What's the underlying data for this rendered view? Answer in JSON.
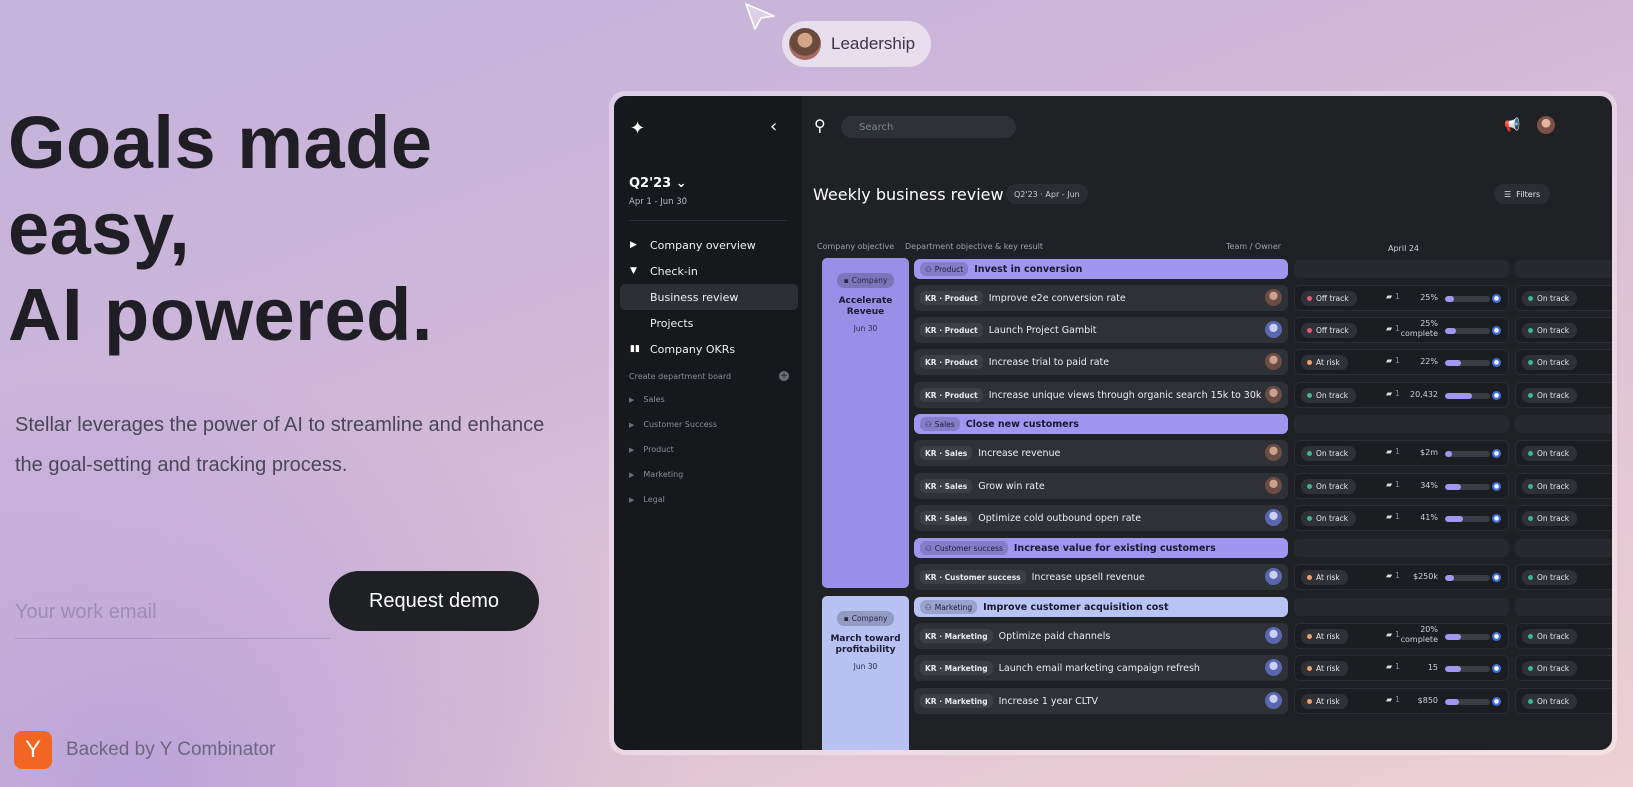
{
  "hero": {
    "title_line1": "Goals made",
    "title_line2": "easy,",
    "title_line3": "AI powered.",
    "subtitle": "Stellar leverages the power of AI to streamline and enhance the goal-setting and tracking process.",
    "email_placeholder": "Your work email",
    "cta_label": "Request demo",
    "backed_logo": "Y",
    "backed_text": "Backed by Y Combinator"
  },
  "cursor_chip": {
    "label": "Leadership"
  },
  "app": {
    "sidebar": {
      "quarter": "Q2'23",
      "range": "Apr 1 - Jun 30",
      "nav": [
        {
          "label": "Company overview"
        },
        {
          "label": "Check-in"
        },
        {
          "label": "Business review"
        },
        {
          "label": "Projects"
        },
        {
          "label": "Company OKRs"
        }
      ],
      "create_label": "Create department board",
      "departments": [
        "Sales",
        "Customer Success",
        "Product",
        "Marketing",
        "Legal"
      ]
    },
    "search_placeholder": "Search",
    "page_title": "Weekly business review",
    "quarter_pill": "Q2'23 · Apr - Jun",
    "filters_label": "Filters",
    "col_company": "Company objective",
    "col_dept": "Department objective & key result",
    "col_team": "Team / Owner",
    "col_date": "April 24",
    "objectives": [
      {
        "tag": "Company",
        "title": "Accelerate Reveue",
        "date": "Jun 30"
      },
      {
        "tag": "Company",
        "title": "March toward profitability",
        "date": "Jun 30"
      }
    ],
    "colors": {
      "on_track": "#3fb58a",
      "off_track": "#e4587a",
      "at_risk": "#f0a06a",
      "accent": "#a195ef"
    },
    "rows": [
      {
        "kind": "head",
        "style": "purple",
        "tag": "Product",
        "title": "Invest in conversion"
      },
      {
        "kind": "kr",
        "tag": "KR · Product",
        "title": "Improve e2e conversion rate",
        "status": "Off track",
        "dot": "off_track",
        "comments": "1",
        "value": "25%",
        "progress": 0.2,
        "owner": "brown",
        "status2": "On track"
      },
      {
        "kind": "kr",
        "tag": "KR · Product",
        "title": "Launch Project Gambit",
        "status": "Off track",
        "dot": "off_track",
        "comments": "1",
        "value": "25%",
        "value2": "complete",
        "progress": 0.25,
        "owner": "blue",
        "status2": "On track"
      },
      {
        "kind": "kr",
        "tag": "KR · Product",
        "title": "Increase trial to paid rate",
        "status": "At risk",
        "dot": "at_risk",
        "comments": "1",
        "value": "22%",
        "progress": 0.35,
        "owner": "brown",
        "status2": "On track"
      },
      {
        "kind": "kr",
        "tag": "KR · Product",
        "title": "Increase unique views through organic search 15k to 30k",
        "status": "On track",
        "dot": "on_track",
        "comments": "1",
        "value": "20,432",
        "progress": 0.6,
        "owner": "brown",
        "status2": "On track"
      },
      {
        "kind": "head",
        "style": "purple",
        "tag": "Sales",
        "title": "Close new customers"
      },
      {
        "kind": "kr",
        "tag": "KR · Sales",
        "title": "Increase revenue",
        "status": "On track",
        "dot": "on_track",
        "comments": "1",
        "value": "$2m",
        "progress": 0.15,
        "owner": "brown",
        "status2": "On track"
      },
      {
        "kind": "kr",
        "tag": "KR · Sales",
        "title": "Grow win rate",
        "status": "On track",
        "dot": "on_track",
        "comments": "1",
        "value": "34%",
        "progress": 0.35,
        "owner": "brown",
        "status2": "On track"
      },
      {
        "kind": "kr",
        "tag": "KR · Sales",
        "title": "Optimize cold outbound open rate",
        "status": "On track",
        "dot": "on_track",
        "comments": "1",
        "value": "41%",
        "progress": 0.4,
        "owner": "blue",
        "status2": "On track"
      },
      {
        "kind": "head",
        "style": "purple",
        "tag": "Customer success",
        "title": "Increase value for existing customers"
      },
      {
        "kind": "kr",
        "tag": "KR · Customer success",
        "title": "Increase upsell revenue",
        "status": "At risk",
        "dot": "at_risk",
        "comments": "1",
        "value": "$250k",
        "progress": 0.2,
        "owner": "blue",
        "status2": "On track"
      },
      {
        "kind": "head",
        "style": "light",
        "tag": "Marketing",
        "title": "Improve customer acquisition cost"
      },
      {
        "kind": "kr",
        "tag": "KR · Marketing",
        "title": "Optimize paid channels",
        "status": "At risk",
        "dot": "at_risk",
        "comments": "1",
        "value": "20%",
        "value2": "complete",
        "progress": 0.35,
        "owner": "blue",
        "status2": "On track"
      },
      {
        "kind": "kr",
        "tag": "KR · Marketing",
        "title": "Launch email marketing campaign refresh",
        "status": "At risk",
        "dot": "at_risk",
        "comments": "1",
        "value": "15",
        "progress": 0.35,
        "owner": "blue",
        "status2": "On track"
      },
      {
        "kind": "kr",
        "tag": "KR · Marketing",
        "title": "Increase  1 year CLTV",
        "status": "At risk",
        "dot": "at_risk",
        "comments": "1",
        "value": "$850",
        "progress": 0.3,
        "owner": "blue",
        "status2": "On track"
      }
    ]
  }
}
